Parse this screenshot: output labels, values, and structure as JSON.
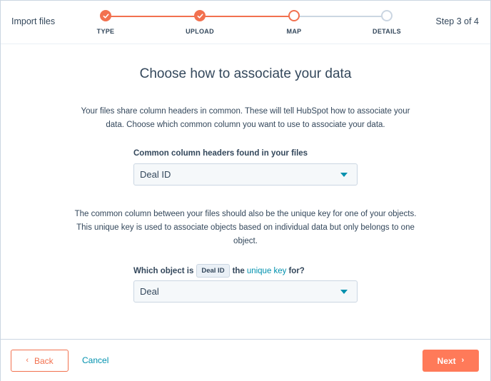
{
  "header": {
    "title": "Import files",
    "step_counter": "Step 3 of 4",
    "steps": [
      {
        "label": "TYPE",
        "state": "done"
      },
      {
        "label": "UPLOAD",
        "state": "done"
      },
      {
        "label": "MAP",
        "state": "active"
      },
      {
        "label": "DETAILS",
        "state": "todo"
      }
    ]
  },
  "main": {
    "title": "Choose how to associate your data",
    "intro": "Your files share column headers in common. These will tell HubSpot how to associate your data. Choose which common column you want to use to associate your data.",
    "column_label": "Common column headers found in your files",
    "column_value": "Deal ID",
    "explain": "The common column between your files should also be the unique key for one of your objects. This unique key is used to associate objects based on individual data but only belongs to one object.",
    "object_label_prefix": "Which object is",
    "object_tag": "Deal ID",
    "object_label_middle": "the",
    "object_link": "unique key",
    "object_label_suffix": "for?",
    "object_value": "Deal"
  },
  "footer": {
    "back_label": "Back",
    "cancel_label": "Cancel",
    "next_label": "Next"
  },
  "colors": {
    "accent": "#ff7a59",
    "link": "#0091ae",
    "text": "#33475b"
  }
}
